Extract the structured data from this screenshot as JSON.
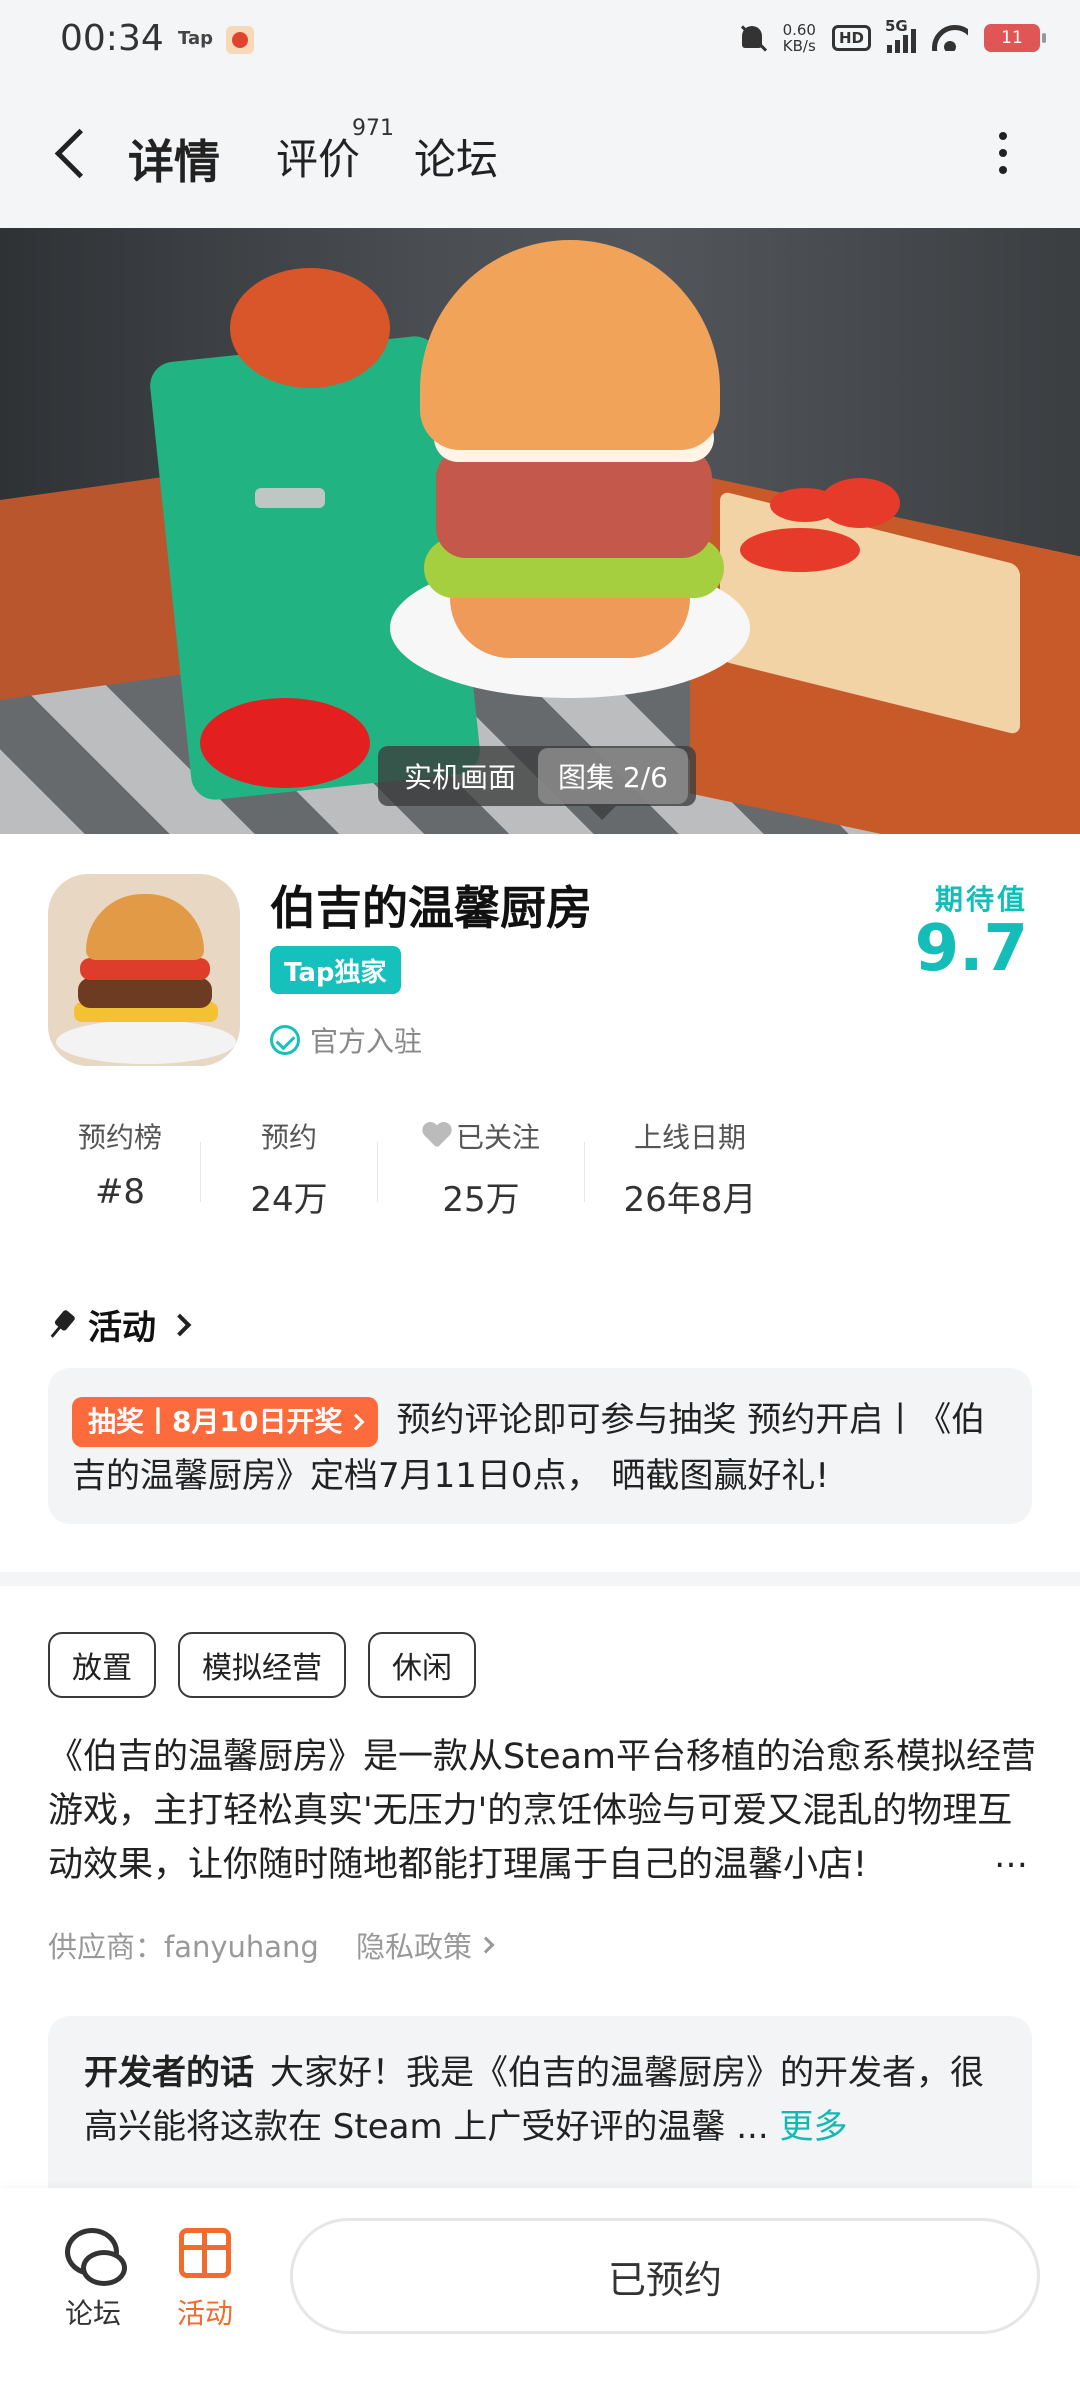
{
  "status_bar": {
    "time": "00:34",
    "app_label": "Tap",
    "net_speed": "0.60",
    "net_unit": "KB/s",
    "hd": "HD",
    "signal": "5G",
    "battery": "11"
  },
  "header": {
    "tabs": [
      {
        "label": "详情",
        "active": true
      },
      {
        "label": "评价",
        "badge": "971"
      },
      {
        "label": "论坛"
      }
    ]
  },
  "hero": {
    "segment_1": "实机画面",
    "segment_2": "图集 2/6"
  },
  "game": {
    "title": "伯吉的温馨厨房",
    "exclusive_badge": "Tap独家",
    "official_label": "官方入驻",
    "expect_label": "期待值",
    "expect_value": "9.7"
  },
  "stats": [
    {
      "label": "预约榜",
      "value": "#8"
    },
    {
      "label": "预约",
      "value": "24万"
    },
    {
      "label": "已关注",
      "value": "25万"
    },
    {
      "label": "上线日期",
      "value": "26年8月"
    }
  ],
  "activity": {
    "header": "活动",
    "tag": "抽奖丨8月10日开奖",
    "text": "预约评论即可参与抽奖 预约开启丨《伯吉的温馨厨房》定档7月11日0点， 晒截图赢好礼!"
  },
  "tags": [
    "放置",
    "模拟经营",
    "休闲"
  ],
  "description": {
    "text": "《伯吉的温馨厨房》是一款从Steam平台移植的治愈系模拟经营游戏，主打轻松真实'无压力'的烹饪体验与可爱又混乱的物理互动效果，让你随时随地都能打理属于自己的温馨小店!",
    "ellipsis": "…"
  },
  "supplier": "供应商：fanyuhang",
  "privacy": "隐私政策",
  "developer": {
    "label": "开发者的话",
    "text": "大家好！我是《伯吉的温馨厨房》的开发者，很高兴能将这款在 Steam 上广受好评的温馨 ...",
    "more": "更多"
  },
  "bottom_bar": {
    "forum": "论坛",
    "activity": "活动",
    "reserved": "已预约"
  },
  "colors": {
    "accent": "#16c1bd",
    "activity_orange": "#f26a2c",
    "tag_orange": "#fd6a3c"
  }
}
